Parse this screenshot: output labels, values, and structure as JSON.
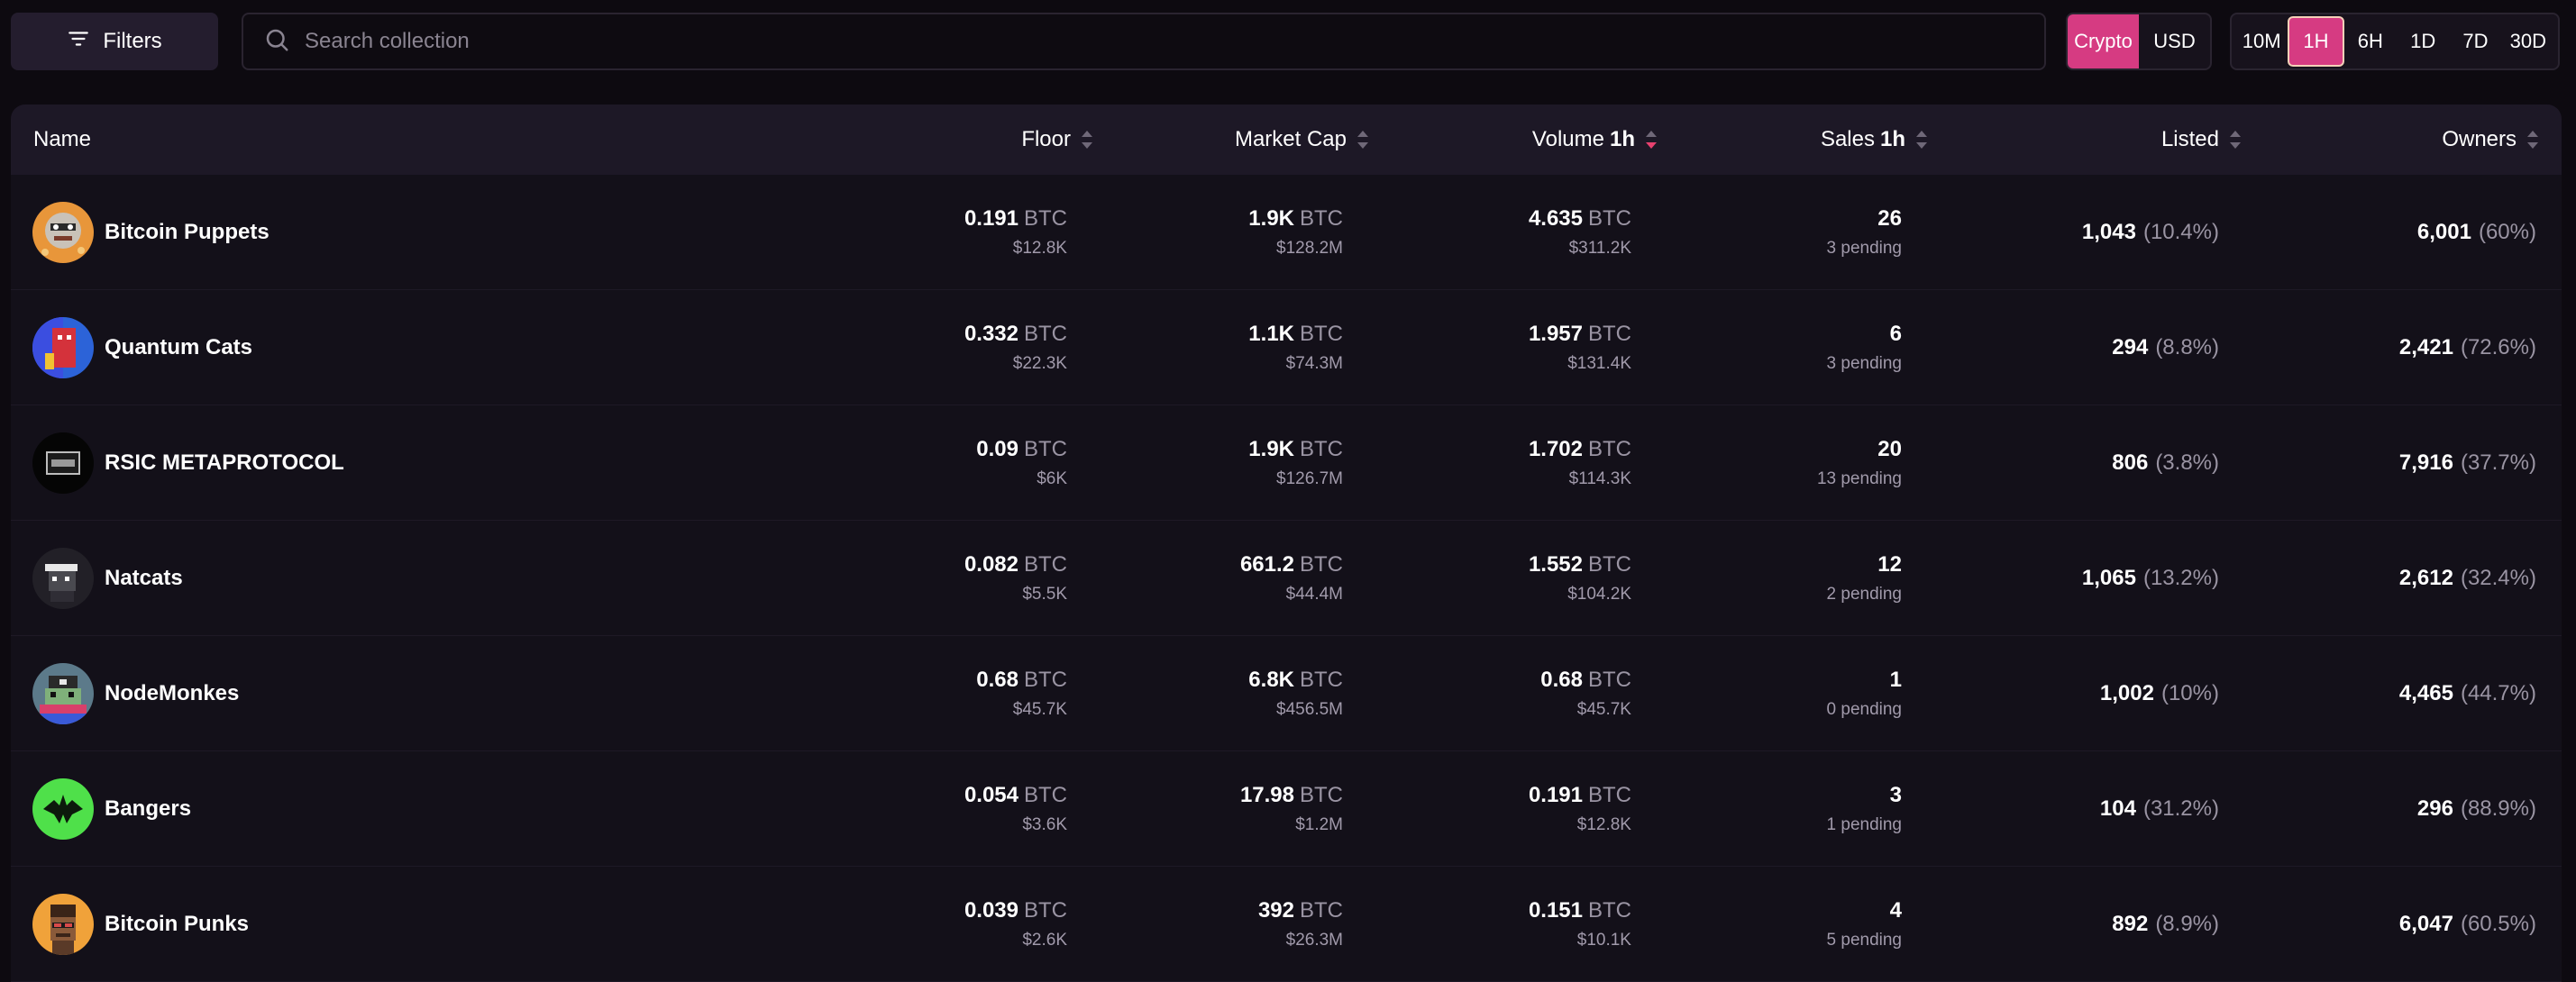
{
  "toolbar": {
    "filters_label": "Filters",
    "search_placeholder": "Search collection",
    "currency_options": [
      "Crypto",
      "USD"
    ],
    "currency_selected": "Crypto",
    "period_options": [
      "10M",
      "1H",
      "6H",
      "1D",
      "7D",
      "30D"
    ],
    "period_selected": "1H"
  },
  "table": {
    "headers": {
      "name": "Name",
      "floor": "Floor",
      "market_cap": "Market Cap",
      "volume": "Volume",
      "volume_period": "1h",
      "sales": "Sales",
      "sales_period": "1h",
      "listed": "Listed",
      "owners": "Owners"
    },
    "sort_active": "volume",
    "rows": [
      {
        "name": "Bitcoin Puppets",
        "avatar": "puppet-avatar",
        "floor": "0.191",
        "floor_unit": "BTC",
        "floor_usd": "$12.8K",
        "mcap": "1.9K",
        "mcap_unit": "BTC",
        "mcap_usd": "$128.2M",
        "volume": "4.635",
        "volume_unit": "BTC",
        "volume_usd": "$311.2K",
        "sales": "26",
        "pending": "3 pending",
        "listed": "1,043",
        "listed_pct": "(10.4%)",
        "owners": "6,001",
        "owners_pct": "(60%)"
      },
      {
        "name": "Quantum Cats",
        "avatar": "quantum-cat-avatar",
        "floor": "0.332",
        "floor_unit": "BTC",
        "floor_usd": "$22.3K",
        "mcap": "1.1K",
        "mcap_unit": "BTC",
        "mcap_usd": "$74.3M",
        "volume": "1.957",
        "volume_unit": "BTC",
        "volume_usd": "$131.4K",
        "sales": "6",
        "pending": "3 pending",
        "listed": "294",
        "listed_pct": "(8.8%)",
        "owners": "2,421",
        "owners_pct": "(72.6%)"
      },
      {
        "name": "RSIC METAPROTOCOL",
        "avatar": "rsic-avatar",
        "floor": "0.09",
        "floor_unit": "BTC",
        "floor_usd": "$6K",
        "mcap": "1.9K",
        "mcap_unit": "BTC",
        "mcap_usd": "$126.7M",
        "volume": "1.702",
        "volume_unit": "BTC",
        "volume_usd": "$114.3K",
        "sales": "20",
        "pending": "13 pending",
        "listed": "806",
        "listed_pct": "(3.8%)",
        "owners": "7,916",
        "owners_pct": "(37.7%)"
      },
      {
        "name": "Natcats",
        "avatar": "natcat-avatar",
        "floor": "0.082",
        "floor_unit": "BTC",
        "floor_usd": "$5.5K",
        "mcap": "661.2",
        "mcap_unit": "BTC",
        "mcap_usd": "$44.4M",
        "volume": "1.552",
        "volume_unit": "BTC",
        "volume_usd": "$104.2K",
        "sales": "12",
        "pending": "2 pending",
        "listed": "1,065",
        "listed_pct": "(13.2%)",
        "owners": "2,612",
        "owners_pct": "(32.4%)"
      },
      {
        "name": "NodeMonkes",
        "avatar": "nodemonke-avatar",
        "floor": "0.68",
        "floor_unit": "BTC",
        "floor_usd": "$45.7K",
        "mcap": "6.8K",
        "mcap_unit": "BTC",
        "mcap_usd": "$456.5M",
        "volume": "0.68",
        "volume_unit": "BTC",
        "volume_usd": "$45.7K",
        "sales": "1",
        "pending": "0 pending",
        "listed": "1,002",
        "listed_pct": "(10%)",
        "owners": "4,465",
        "owners_pct": "(44.7%)"
      },
      {
        "name": "Bangers",
        "avatar": "banger-avatar",
        "floor": "0.054",
        "floor_unit": "BTC",
        "floor_usd": "$3.6K",
        "mcap": "17.98",
        "mcap_unit": "BTC",
        "mcap_usd": "$1.2M",
        "volume": "0.191",
        "volume_unit": "BTC",
        "volume_usd": "$12.8K",
        "sales": "3",
        "pending": "1 pending",
        "listed": "104",
        "listed_pct": "(31.2%)",
        "owners": "296",
        "owners_pct": "(88.9%)"
      },
      {
        "name": "Bitcoin Punks",
        "avatar": "punk-avatar",
        "floor": "0.039",
        "floor_unit": "BTC",
        "floor_usd": "$2.6K",
        "mcap": "392",
        "mcap_unit": "BTC",
        "mcap_usd": "$26.3M",
        "volume": "0.151",
        "volume_unit": "BTC",
        "volume_usd": "$10.1K",
        "sales": "4",
        "pending": "5 pending",
        "listed": "892",
        "listed_pct": "(8.9%)",
        "owners": "6,047",
        "owners_pct": "(60.5%)"
      }
    ]
  },
  "colors": {
    "accent": "#d63b82",
    "background": "#0d0a10",
    "table_bg": "#131019",
    "header_bg": "#1d1826",
    "muted_text": "#9a94a3",
    "sort_active": "#e8416f"
  }
}
